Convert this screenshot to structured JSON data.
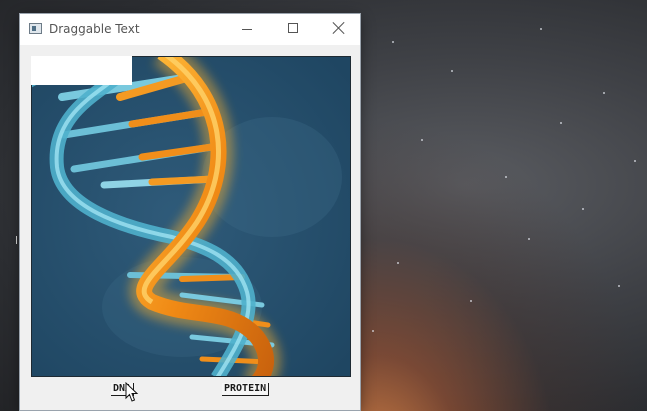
{
  "window": {
    "title": "Draggable Text",
    "controls": {
      "minimize": "minimize-icon",
      "maximize": "maximize-icon",
      "close": "close-icon"
    }
  },
  "labels": {
    "dna": "DNA",
    "protein": "PROTEIN"
  },
  "colors": {
    "dna_background": "#27506e",
    "helix_orange": "#f19a1f",
    "helix_blue": "#6ecfe6"
  }
}
